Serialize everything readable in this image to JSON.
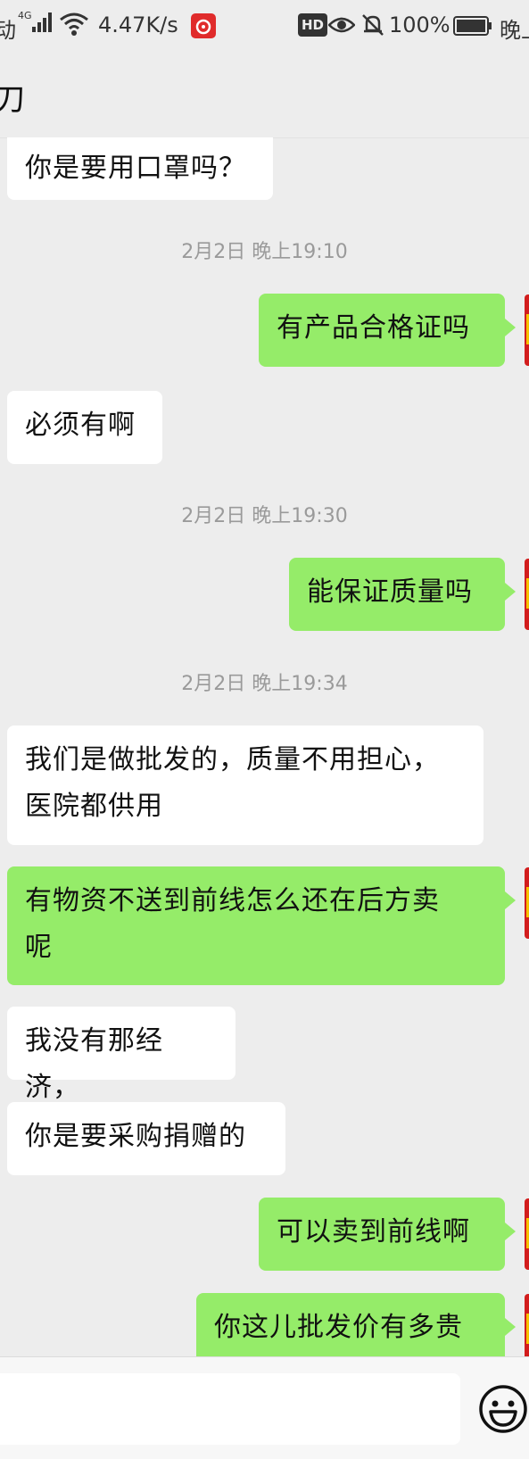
{
  "status_bar": {
    "carrier": "动",
    "network": "4G",
    "speed": "4.47K/s",
    "hd": "HD",
    "battery": "100%",
    "time": "晚上"
  },
  "header": {
    "title": "刀"
  },
  "chat": {
    "messages": [
      {
        "dir": "in",
        "text": "你是要用口罩吗？"
      },
      {
        "dir": "ts",
        "text": "2月2日 晚上19:10"
      },
      {
        "dir": "out",
        "text": "有产品合格证吗"
      },
      {
        "dir": "in",
        "text": "必须有啊"
      },
      {
        "dir": "ts",
        "text": "2月2日 晚上19:30"
      },
      {
        "dir": "out",
        "text": "能保证质量吗"
      },
      {
        "dir": "ts",
        "text": "2月2日 晚上19:34"
      },
      {
        "dir": "in",
        "text_lines": [
          "我们是做批发的，质量不用担心，",
          "医院都供用"
        ]
      },
      {
        "dir": "out",
        "text_lines": [
          "有物资不送到前线怎么还在后方卖",
          "呢"
        ]
      },
      {
        "dir": "in",
        "text": "我没有那经济，"
      },
      {
        "dir": "in",
        "text": "你是要采购捐赠的"
      },
      {
        "dir": "out",
        "text": "可以卖到前线啊"
      },
      {
        "dir": "out",
        "text": "你这儿批发价有多贵"
      }
    ]
  },
  "input": {
    "value": "",
    "placeholder": "",
    "emoji_icon": "smiley-face-icon"
  },
  "colors": {
    "background": "#ededed",
    "outgoing_bubble": "#95ec69",
    "incoming_bubble": "#ffffff",
    "timestamp_text": "#9a9a9a",
    "avatar_red": "#d21d1d"
  }
}
